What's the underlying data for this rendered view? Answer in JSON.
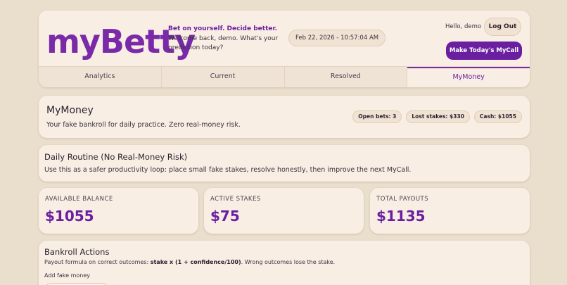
{
  "brand": {
    "logo": "myBetty",
    "tagline": "Bet on yourself. Decide better.",
    "welcome": "Welcome back, demo. What's your prediction today?"
  },
  "header": {
    "datetime": "Feb 22, 2026 - 10:57:04 AM",
    "hello": "Hello, demo",
    "logout_label": "Log Out",
    "make_call_label": "Make Today's MyCall"
  },
  "tabs": [
    {
      "label": "Analytics",
      "active": false
    },
    {
      "label": "Current",
      "active": false
    },
    {
      "label": "Resolved",
      "active": false
    },
    {
      "label": "MyMoney",
      "active": true
    }
  ],
  "mymoney": {
    "title": "MyMoney",
    "subtitle": "Your fake bankroll for daily practice. Zero real-money risk.",
    "badges": [
      "Open bets: 3",
      "Lost stakes: $330",
      "Cash: $1055"
    ]
  },
  "routine": {
    "title": "Daily Routine (No Real-Money Risk)",
    "text": "Use this as a safer productivity loop: place small fake stakes, resolve honestly, then improve the next MyCall."
  },
  "stats": [
    {
      "label": "AVAILABLE BALANCE",
      "value": "$1055"
    },
    {
      "label": "ACTIVE STAKES",
      "value": "$75"
    },
    {
      "label": "TOTAL PAYOUTS",
      "value": "$1135"
    }
  ],
  "bankroll": {
    "title": "Bankroll Actions",
    "formula_prefix": "Payout formula on correct outcomes: ",
    "formula": "stake x (1 + confidence/100)",
    "formula_suffix": ". Wrong outcomes lose the stake.",
    "add_label": "Add fake money"
  },
  "colors": {
    "accent": "#6a1fa0",
    "background": "#eadfcd",
    "card": "#f8eee4"
  }
}
